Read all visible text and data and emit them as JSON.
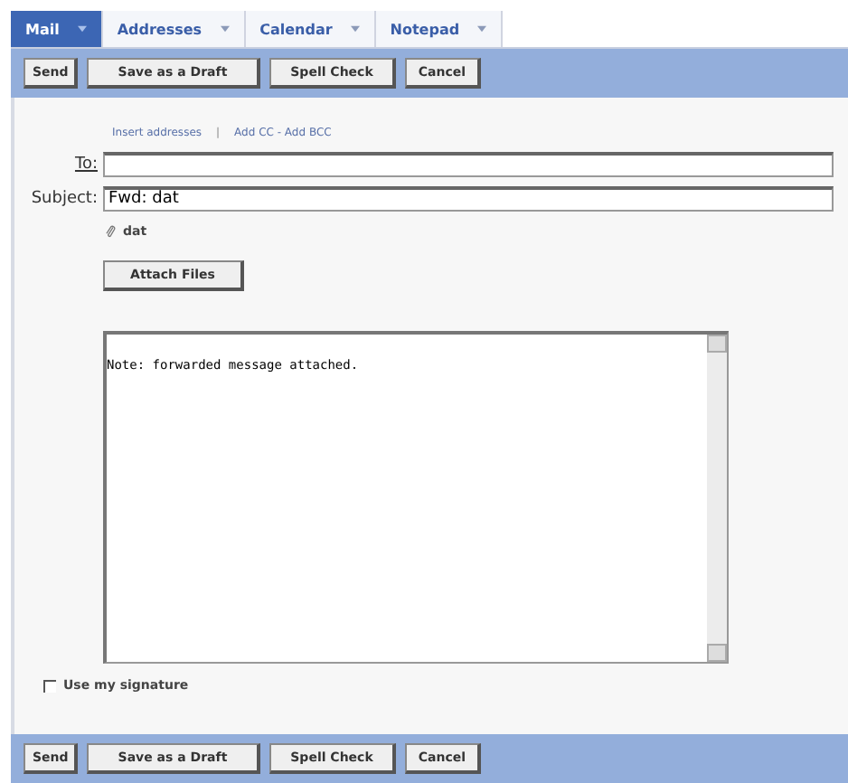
{
  "tabs": [
    {
      "label": "Mail",
      "selected": true
    },
    {
      "label": "Addresses",
      "selected": false
    },
    {
      "label": "Calendar",
      "selected": false
    },
    {
      "label": "Notepad",
      "selected": false
    }
  ],
  "toolbar_top": [
    "Send",
    "Save as a Draft",
    "Spell Check",
    "Cancel"
  ],
  "address_links": [
    {
      "label": "Insert addresses"
    },
    {
      "label": "Add CC - Add BCC"
    }
  ],
  "address_separator": "|",
  "to": {
    "label": "To:"
  },
  "subject": {
    "label": "Subject:",
    "value": "Fwd: dat"
  },
  "attachments": [
    "dat"
  ],
  "attach_button": "Attach Files",
  "body": "Note: forwarded message attached.",
  "signature": {
    "label": "Use my signature",
    "checked": false
  },
  "toolbar_bottom": [
    "Send",
    "Save as a Draft",
    "Spell Check",
    "Cancel"
  ]
}
